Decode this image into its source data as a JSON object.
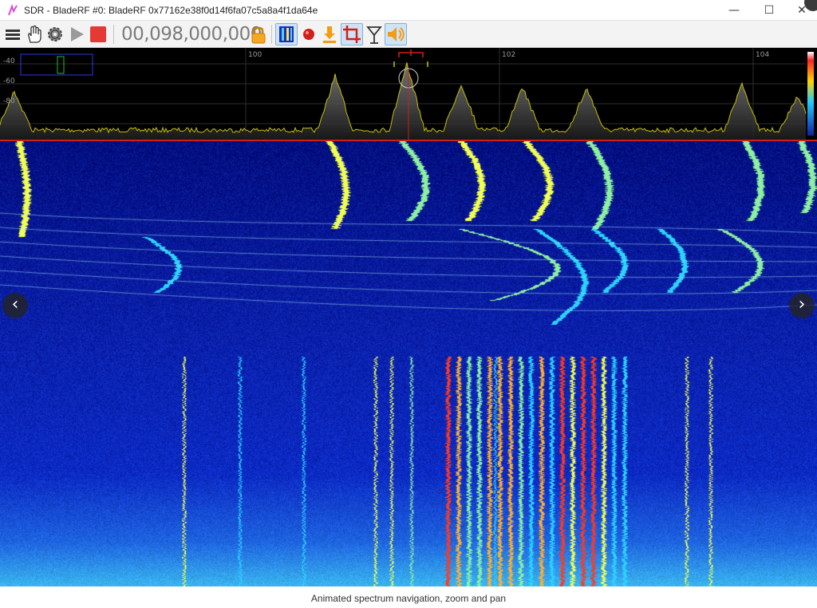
{
  "window": {
    "title": "SDR - BladeRF #0: BladeRF 0x77162e38f0d14f6fa07c5a8a4f1da64e",
    "minimize_glyph": "—",
    "maximize_glyph": "☐",
    "close_glyph": "✕"
  },
  "toolbar": {
    "frequency": "00,098,000,000",
    "icons": [
      "menu-icon",
      "hand-pan-icon",
      "gear-icon",
      "play-icon",
      "stop-icon",
      "lock-icon",
      "waterfall-icon",
      "record-icon",
      "download-icon",
      "crop-zoom-icon",
      "antenna-icon",
      "speaker-icon"
    ]
  },
  "spectrum": {
    "db_labels": [
      "-40",
      "-60",
      "-80"
    ],
    "freq_labels": [
      "100",
      "102",
      "104"
    ]
  },
  "navigation": {
    "prev_glyph": "‹",
    "next_glyph": "›"
  },
  "caption": "Animated spectrum navigation, zoom and pan",
  "colors": {
    "spectrum_trace": "#c8c000",
    "waterfall_background": "#02128a",
    "active_tool": "#cfe3f6",
    "stop_red": "#e53935",
    "accent_orange": "#f39c12"
  }
}
